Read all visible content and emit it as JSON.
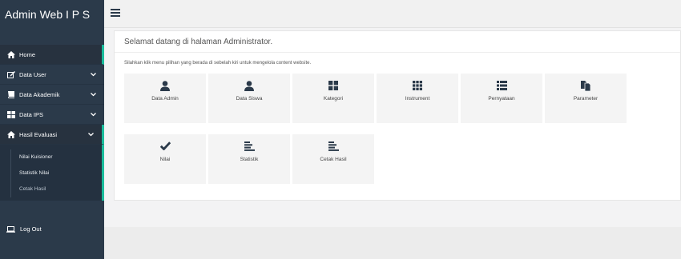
{
  "brand": {
    "title": "Admin Web I P S"
  },
  "sidebar": {
    "items": [
      {
        "label": "Home",
        "icon": "home-icon"
      },
      {
        "label": "Data User",
        "icon": "edit-icon"
      },
      {
        "label": "Data Akademik",
        "icon": "book-icon"
      },
      {
        "label": "Data IPS",
        "icon": "windows-icon"
      },
      {
        "label": "Hasil Evaluasi",
        "icon": "home-icon"
      }
    ],
    "sub_items": [
      "Nilai Kuisioner",
      "Statistik Nilai",
      "Cetak Hasil"
    ],
    "logout": "Log Out"
  },
  "panel": {
    "title": "Selamat datang di halaman Administrator.",
    "description": "Silahkan klik menu pilihan yang berada di sebelah kiri untuk mengelola content website."
  },
  "tiles": [
    {
      "label": "Data Admin",
      "icon": "user-icon"
    },
    {
      "label": "Data Siswa",
      "icon": "user-icon"
    },
    {
      "label": "Kategori",
      "icon": "grid-icon"
    },
    {
      "label": "Instrument",
      "icon": "grid-dots-icon"
    },
    {
      "label": "Pernyataan",
      "icon": "list-icon"
    },
    {
      "label": "Parameter",
      "icon": "copy-icon"
    },
    {
      "label": "Nilai",
      "icon": "check-icon"
    },
    {
      "label": "Statistik",
      "icon": "align-left-icon"
    },
    {
      "label": "Cetak Hasil",
      "icon": "align-left-icon"
    }
  ],
  "colors": {
    "sidebar": "#2b3a4a",
    "accent": "#1abc9c",
    "icon": "#2b3a4a"
  }
}
